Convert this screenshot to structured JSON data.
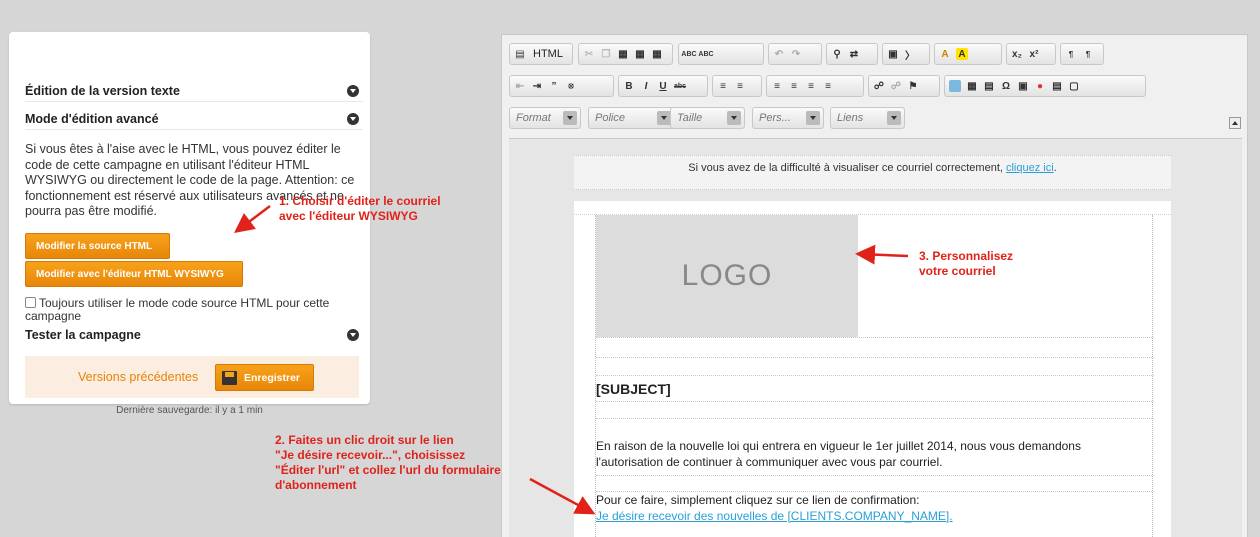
{
  "left_panel": {
    "sections": {
      "text_version": "Édition de la version texte",
      "advanced_mode": "Mode d'édition avancé",
      "test_campaign": "Tester la campagne"
    },
    "description": "Si vous êtes à l'aise avec le HTML, vous pouvez éditer le code de cette campagne en utilisant l'éditeur HTML WYSIWYG ou directement le code de la page. Attention: ce fonctionnement est réservé aux utilisateurs avancés et ne pourra pas être modifié.",
    "btn_source": "Modifier la source HTML",
    "btn_wysiwyg": "Modifier avec l'éditeur HTML WYSIWYG",
    "checkbox_label": "Toujours utiliser le mode code source HTML pour cette campagne",
    "checkbox_checked": false,
    "versions_link": "Versions précédentes",
    "save_button": "Enregistrer",
    "last_save": "Dernière sauvegarde: il y a 1 min"
  },
  "annotations": {
    "a1_line1": "1. Choisir d'éditer le courriel",
    "a1_line2": "avec l'éditeur WYSIWYG",
    "a2_line1": "2. Faites un clic droit sur le lien",
    "a2_line2": "\"Je désire recevoir...\", choisissez",
    "a2_line3": "\"Éditer l'url\" et collez l'url du formulaire",
    "a2_line4": "d'abonnement",
    "a3_line1": "3. Personnalisez",
    "a3_line2": "votre courriel",
    "color": "#e0221a"
  },
  "toolbar": {
    "html_label": "HTML",
    "combos": [
      "Format",
      "Police",
      "Taille",
      "Pers...",
      "Liens"
    ]
  },
  "email": {
    "preheader_text": "Si vous avez de la difficulté à visualiser ce courriel correctement, ",
    "preheader_link": "cliquez ici",
    "preheader_end": ".",
    "logo": "LOGO",
    "subject": "[SUBJECT]",
    "body1": "En raison de la nouvelle loi qui entrera en vigueur le 1er juillet 2014, nous vous demandons l'autorisation de continuer à communiquer avec vous par courriel.",
    "body2": "Pour ce faire, simplement cliquez sur ce lien de confirmation:",
    "confirm_link": "Je désire recevoir des nouvelles de [CLIENTS.COMPANY_NAME]."
  },
  "colors": {
    "accent": "#f39a14",
    "link": "#2a9fd6",
    "background": "#d6d6d6"
  }
}
